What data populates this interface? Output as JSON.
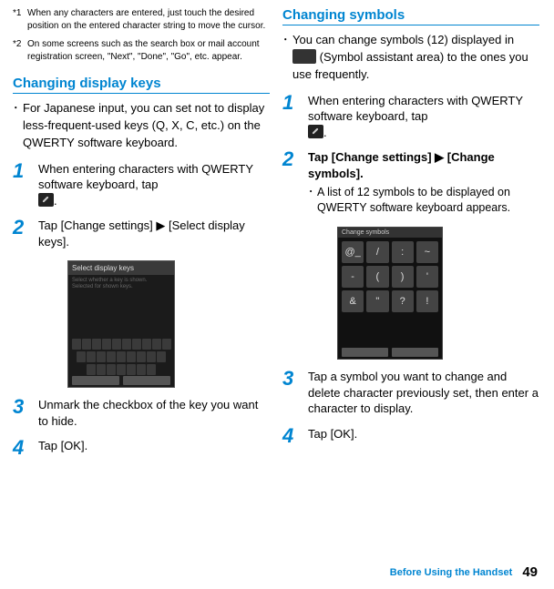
{
  "footnotes": {
    "fn1": {
      "label": "*1",
      "text": "When any characters are entered, just touch the desired position on the entered character string to move the cursor."
    },
    "fn2": {
      "label": "*2",
      "text": "On some screens such as the search box or mail account registration screen, \"Next\", \"Done\", \"Go\", etc. appear."
    }
  },
  "left": {
    "heading": "Changing display keys",
    "intro": "For Japanese input, you can set not to display less-frequent-used keys (Q, X, C, etc.) on the QWERTY software keyboard.",
    "step1": "When entering characters with QWERTY software keyboard, tap ",
    "step1_end": ".",
    "step2_a": "Tap [Change settings] ",
    "step2_b": " [Select display keys].",
    "step3": "Unmark the checkbox of the key you want to hide.",
    "step4": "Tap [OK]."
  },
  "right": {
    "heading": "Changing symbols",
    "intro_a": "You can change symbols (12) displayed in ",
    "intro_b": " (Symbol assistant area) to the ones you use frequently.",
    "step1": "When entering characters with QWERTY software keyboard, tap ",
    "step1_end": ".",
    "step2_a": "Tap [Change settings] ",
    "step2_b": " [Change symbols].",
    "step2_sub": "A list of 12 symbols to be displayed on QWERTY software keyboard appears.",
    "step3": "Tap a symbol you want to change and delete character previously set, then enter a character to display.",
    "step4": "Tap [OK]."
  },
  "shot1": {
    "title": "Select display keys"
  },
  "shot2": {
    "title": "Change symbols",
    "symbols": [
      "@_",
      "/",
      ":",
      "~",
      "-",
      "(",
      ")",
      "'",
      "&",
      "\"",
      "?",
      "!"
    ]
  },
  "footer": {
    "section": "Before Using the Handset",
    "page": "49"
  },
  "arrow": "▶"
}
